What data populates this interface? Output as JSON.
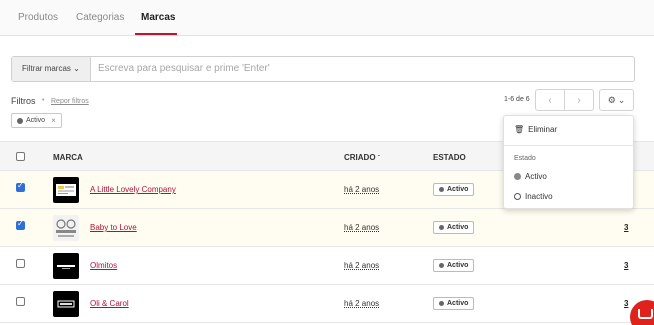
{
  "tabs": [
    {
      "label": "Produtos"
    },
    {
      "label": "Categorias"
    },
    {
      "label": "Marcas"
    }
  ],
  "search": {
    "filter_label": "Filtrar marcas",
    "placeholder": "Escreva para pesquisar e prime 'Enter'"
  },
  "filters": {
    "label": "Filtros",
    "reset_label": "Repor filtros",
    "active_chip": "Activo"
  },
  "pagination": {
    "info": "1-6 de 6",
    "prev": "‹",
    "next": "›"
  },
  "table": {
    "headers": {
      "brand": "MARCA",
      "created": "CRIADO",
      "status": "ESTADO"
    },
    "rows": [
      {
        "brand": "A Little Lovely Company",
        "created": "há 2 anos",
        "status": "Activo",
        "count": "",
        "checked": true
      },
      {
        "brand": "Baby to Love",
        "created": "há 2 anos",
        "status": "Activo",
        "count": "3",
        "checked": true
      },
      {
        "brand": "Olmitos",
        "created": "há 2 anos",
        "status": "Activo",
        "count": "3",
        "checked": false
      },
      {
        "brand": "Oli & Carol",
        "created": "há 2 anos",
        "status": "Activo",
        "count": "3",
        "checked": false
      }
    ]
  },
  "menu": {
    "delete_label": "Eliminar",
    "section_label": "Estado",
    "options": [
      {
        "label": "Activo"
      },
      {
        "label": "Inactivo"
      }
    ]
  },
  "colors": {
    "accent": "#c8102e",
    "link": "#b0103a",
    "checkbox": "#2f6fd6",
    "selected_row": "#fffdf1",
    "chat": "#e0221c"
  }
}
